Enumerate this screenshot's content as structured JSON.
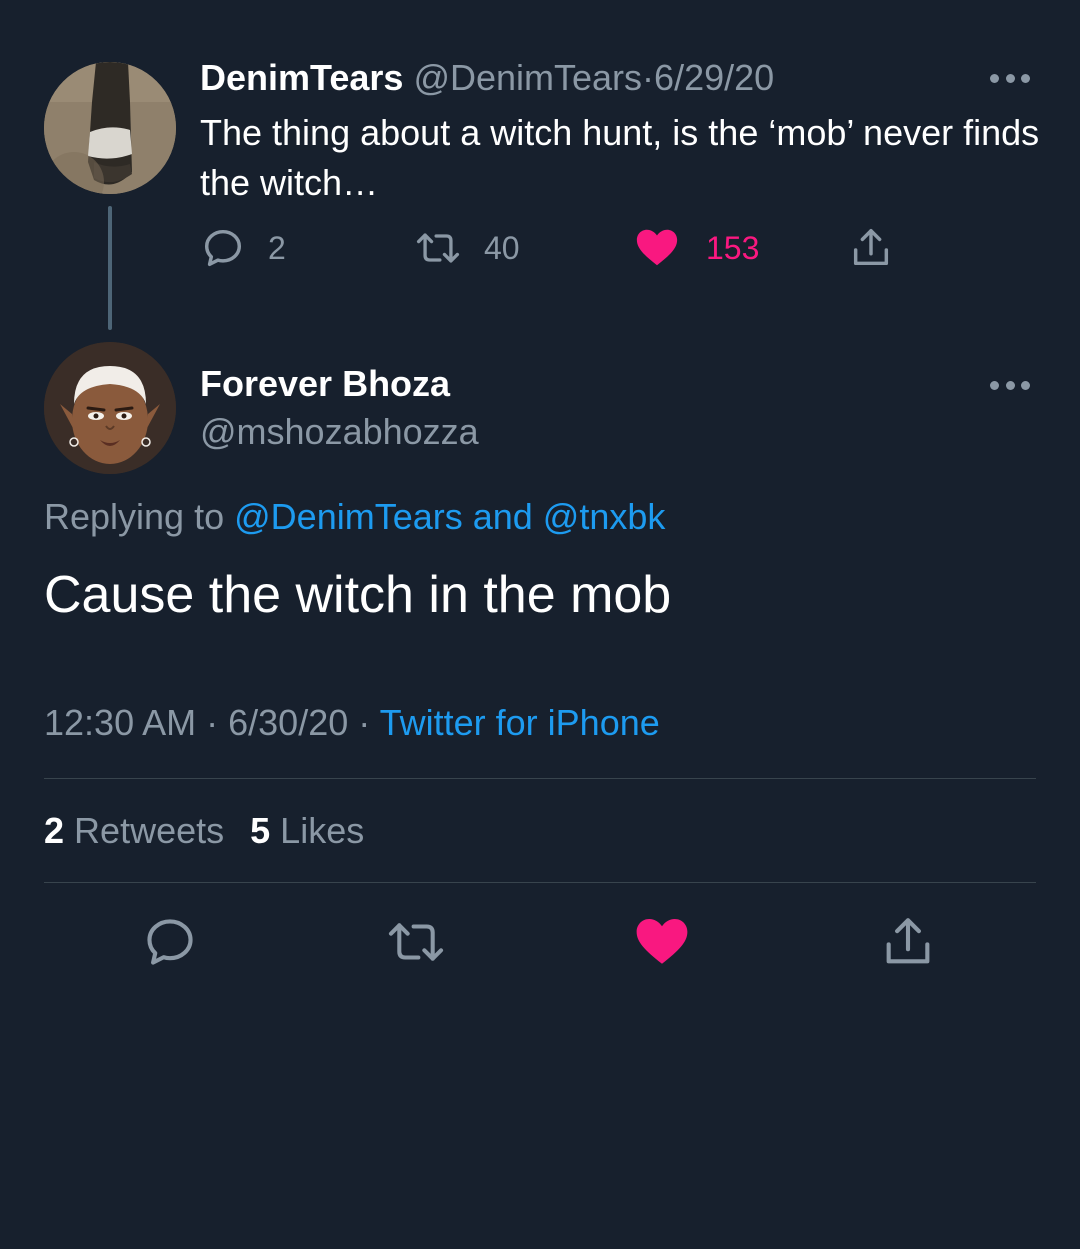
{
  "parent_tweet": {
    "display_name": "DenimTears",
    "handle": "@DenimTears",
    "separator": "·",
    "date": "6/29/20",
    "text": "The thing about a witch hunt, is the ‘mob’ never finds the witch…",
    "actions": {
      "reply_count": "2",
      "retweet_count": "40",
      "like_count": "153"
    }
  },
  "reply_tweet": {
    "display_name": "Forever Bhoza",
    "handle": "@mshozabhozza",
    "replying_prefix": "Replying to",
    "replying_targets": "@DenimTears and @tnxbk",
    "text": "Cause the witch in the mob",
    "time": "12:30 AM",
    "separator": "·",
    "date": "6/30/20",
    "source": "Twitter for iPhone",
    "retweets_count": "2",
    "retweets_label": "Retweets",
    "likes_count": "5",
    "likes_label": "Likes"
  },
  "colors": {
    "background": "#17202d",
    "muted_text": "#8b98a5",
    "link": "#1d9bf0",
    "like": "#f91880",
    "divider": "#38444d"
  },
  "icons": [
    "reply-icon",
    "retweet-icon",
    "heart-icon",
    "share-icon",
    "more-icon"
  ]
}
